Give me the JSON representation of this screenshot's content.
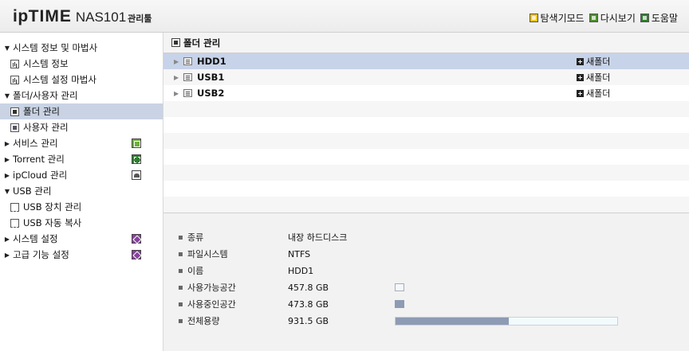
{
  "header": {
    "logo_ip": "ip",
    "logo_time": "TIME",
    "logo_model": "NAS101",
    "logo_suffix": "관리툴",
    "links": [
      {
        "label": "탐색기모드",
        "icon": "explorer-mode-icon",
        "color": "#f0c419"
      },
      {
        "label": "다시보기",
        "icon": "refresh-icon",
        "color": "#4c8f2c"
      },
      {
        "label": "도움말",
        "icon": "help-icon",
        "color": "#2f7d2f"
      }
    ]
  },
  "sidebar": {
    "groups": [
      {
        "label": "시스템 정보 및 마법사",
        "expanded": true,
        "children": [
          {
            "label": "시스템 정보",
            "icon": "chart-icon"
          },
          {
            "label": "시스템 설정 마법사",
            "icon": "chart-icon"
          }
        ]
      },
      {
        "label": "폴더/사용자 관리",
        "expanded": true,
        "children": [
          {
            "label": "폴더 관리",
            "icon": "folder-icon",
            "active": true
          },
          {
            "label": "사용자 관리",
            "icon": "user-icon"
          }
        ]
      },
      {
        "label": "서비스 관리",
        "expanded": false,
        "right_icon": "green"
      },
      {
        "label": "Torrent 관리",
        "expanded": false,
        "right_icon": "greendark"
      },
      {
        "label": "ipCloud 관리",
        "expanded": false,
        "right_icon": "gray"
      },
      {
        "label": "USB 관리",
        "expanded": true,
        "children": [
          {
            "label": "USB 장치 관리",
            "icon": "usb-icon"
          },
          {
            "label": "USB 자동 복사",
            "icon": "usb-icon"
          }
        ]
      },
      {
        "label": "시스템 설정",
        "expanded": false,
        "right_icon": "purple"
      },
      {
        "label": "고급 기능 설정",
        "expanded": false,
        "right_icon": "purple"
      }
    ]
  },
  "main": {
    "title": "폴더 관리",
    "devices": [
      {
        "name": "HDD1",
        "action": "새폴더",
        "selected": true
      },
      {
        "name": "USB1",
        "action": "새폴더",
        "selected": false
      },
      {
        "name": "USB2",
        "action": "새폴더",
        "selected": false
      }
    ],
    "details": {
      "type_label": "종류",
      "type_value": "내장 하드디스크",
      "fs_label": "파일시스템",
      "fs_value": "NTFS",
      "name_label": "이름",
      "name_value": "HDD1",
      "free_label": "사용가능공간",
      "free_value": "457.8 GB",
      "used_label": "사용중인공간",
      "used_value": "473.8 GB",
      "total_label": "전체용량",
      "total_value": "931.5 GB",
      "used_fraction": 0.509
    }
  },
  "colors": {
    "selected_row": "#c7d3e8",
    "active_nav": "#c9d3e4",
    "usage_bar": "#8e9bb4"
  }
}
